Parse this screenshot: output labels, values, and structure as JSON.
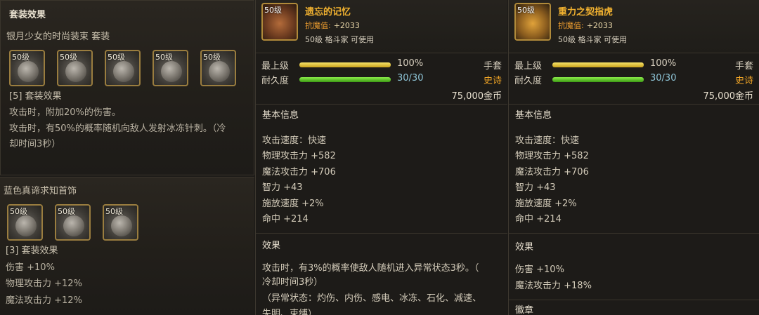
{
  "set_panel_1": {
    "title": "套装效果",
    "set_name": "银月少女的时尚装束 套装",
    "slots": [
      "50级",
      "50级",
      "50级",
      "50级",
      "50级"
    ],
    "effect_header": "[5] 套装效果",
    "effects": [
      "攻击时，附加20%的伤害。",
      "攻击时，有50%的概率随机向敌人发射冰冻针刺。（冷",
      "却时间3秒）"
    ]
  },
  "set_panel_2": {
    "set_name": "蓝色真谛求知首饰",
    "slots": [
      "50级",
      "50级",
      "50级"
    ],
    "effect_header": "[3] 套装效果",
    "effects": [
      "伤害 +10%",
      "物理攻击力 +12%",
      "魔法攻击力 +12%"
    ]
  },
  "item1": {
    "level": "50级",
    "name": "遗忘的记忆",
    "resist_label": "抗魔值:",
    "resist_value": "+2033",
    "requirement": "50级 格斗家 可使用",
    "max_level_label": "最上级",
    "max_level_value": "100%",
    "max_level_fill": 1.0,
    "durability_label": "耐久度",
    "durability_value": "30/30",
    "durability_fill": 1.0,
    "slot_type": "手套",
    "rarity": "史诗",
    "price": "75,000金币",
    "basic_info_title": "基本信息",
    "basic_stats": [
      "攻击速度：快速",
      "物理攻击力 +582",
      "魔法攻击力 +706",
      "智力 +43",
      "施放速度 +2%",
      "命中 +214"
    ],
    "effect_title": "效果",
    "effect_lines": [
      "攻击时，有3%的概率使敌人随机进入异常状态3秒。（",
      "冷却时间3秒）",
      "（异常状态：灼伤、内伤、感电、冰冻、石化、减速、",
      "失明、束缚）"
    ]
  },
  "item2": {
    "level": "50级",
    "name": "重力之契指虎",
    "resist_label": "抗魔值:",
    "resist_value": "+2033",
    "requirement": "50级 格斗家 可使用",
    "max_level_label": "最上级",
    "max_level_value": "100%",
    "max_level_fill": 1.0,
    "durability_label": "耐久度",
    "durability_value": "30/30",
    "durability_fill": 1.0,
    "slot_type": "手套",
    "rarity": "史诗",
    "price": "75,000金币",
    "basic_info_title": "基本信息",
    "basic_stats": [
      "攻击速度：快速",
      "物理攻击力 +582",
      "魔法攻击力 +706",
      "智力 +43",
      "施放速度 +2%",
      "命中 +214"
    ],
    "effect_title": "效果",
    "effect_lines": [
      "伤害 +10%",
      "魔法攻击力 +18%"
    ],
    "emblem_title": "徽章"
  }
}
